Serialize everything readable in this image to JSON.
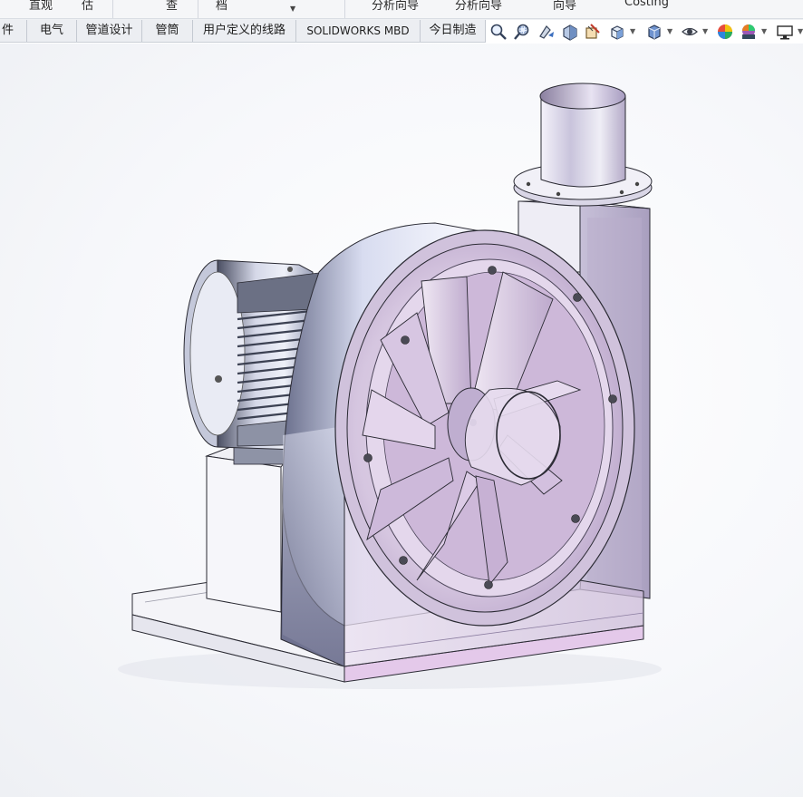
{
  "ribbon": {
    "labels": [
      "直观",
      "估",
      "查",
      "档",
      "分析向导",
      "分析向导",
      "向导",
      "Costing"
    ]
  },
  "tabs": [
    {
      "label": "件"
    },
    {
      "label": "电气"
    },
    {
      "label": "管道设计"
    },
    {
      "label": "管筒"
    },
    {
      "label": "用户定义的线路"
    },
    {
      "label": "SOLIDWORKS MBD"
    },
    {
      "label": "今日制造"
    }
  ],
  "view_toolbar": {
    "icons": [
      "zoom-to-fit-icon",
      "zoom-to-area-icon",
      "previous-view-icon",
      "section-view-icon",
      "dynamic-annotation-icon",
      "view-orientation-icon",
      "display-style-icon",
      "hide-show-items-icon",
      "edit-appearance-icon",
      "apply-scene-icon",
      "view-settings-icon"
    ]
  },
  "colors": {
    "housing_tint": "#d9c6e2",
    "metal_light": "#f4f4fa",
    "metal_dark": "#6b6f86",
    "motor_fins": "#5a6070",
    "edge": "#2a2a33"
  }
}
